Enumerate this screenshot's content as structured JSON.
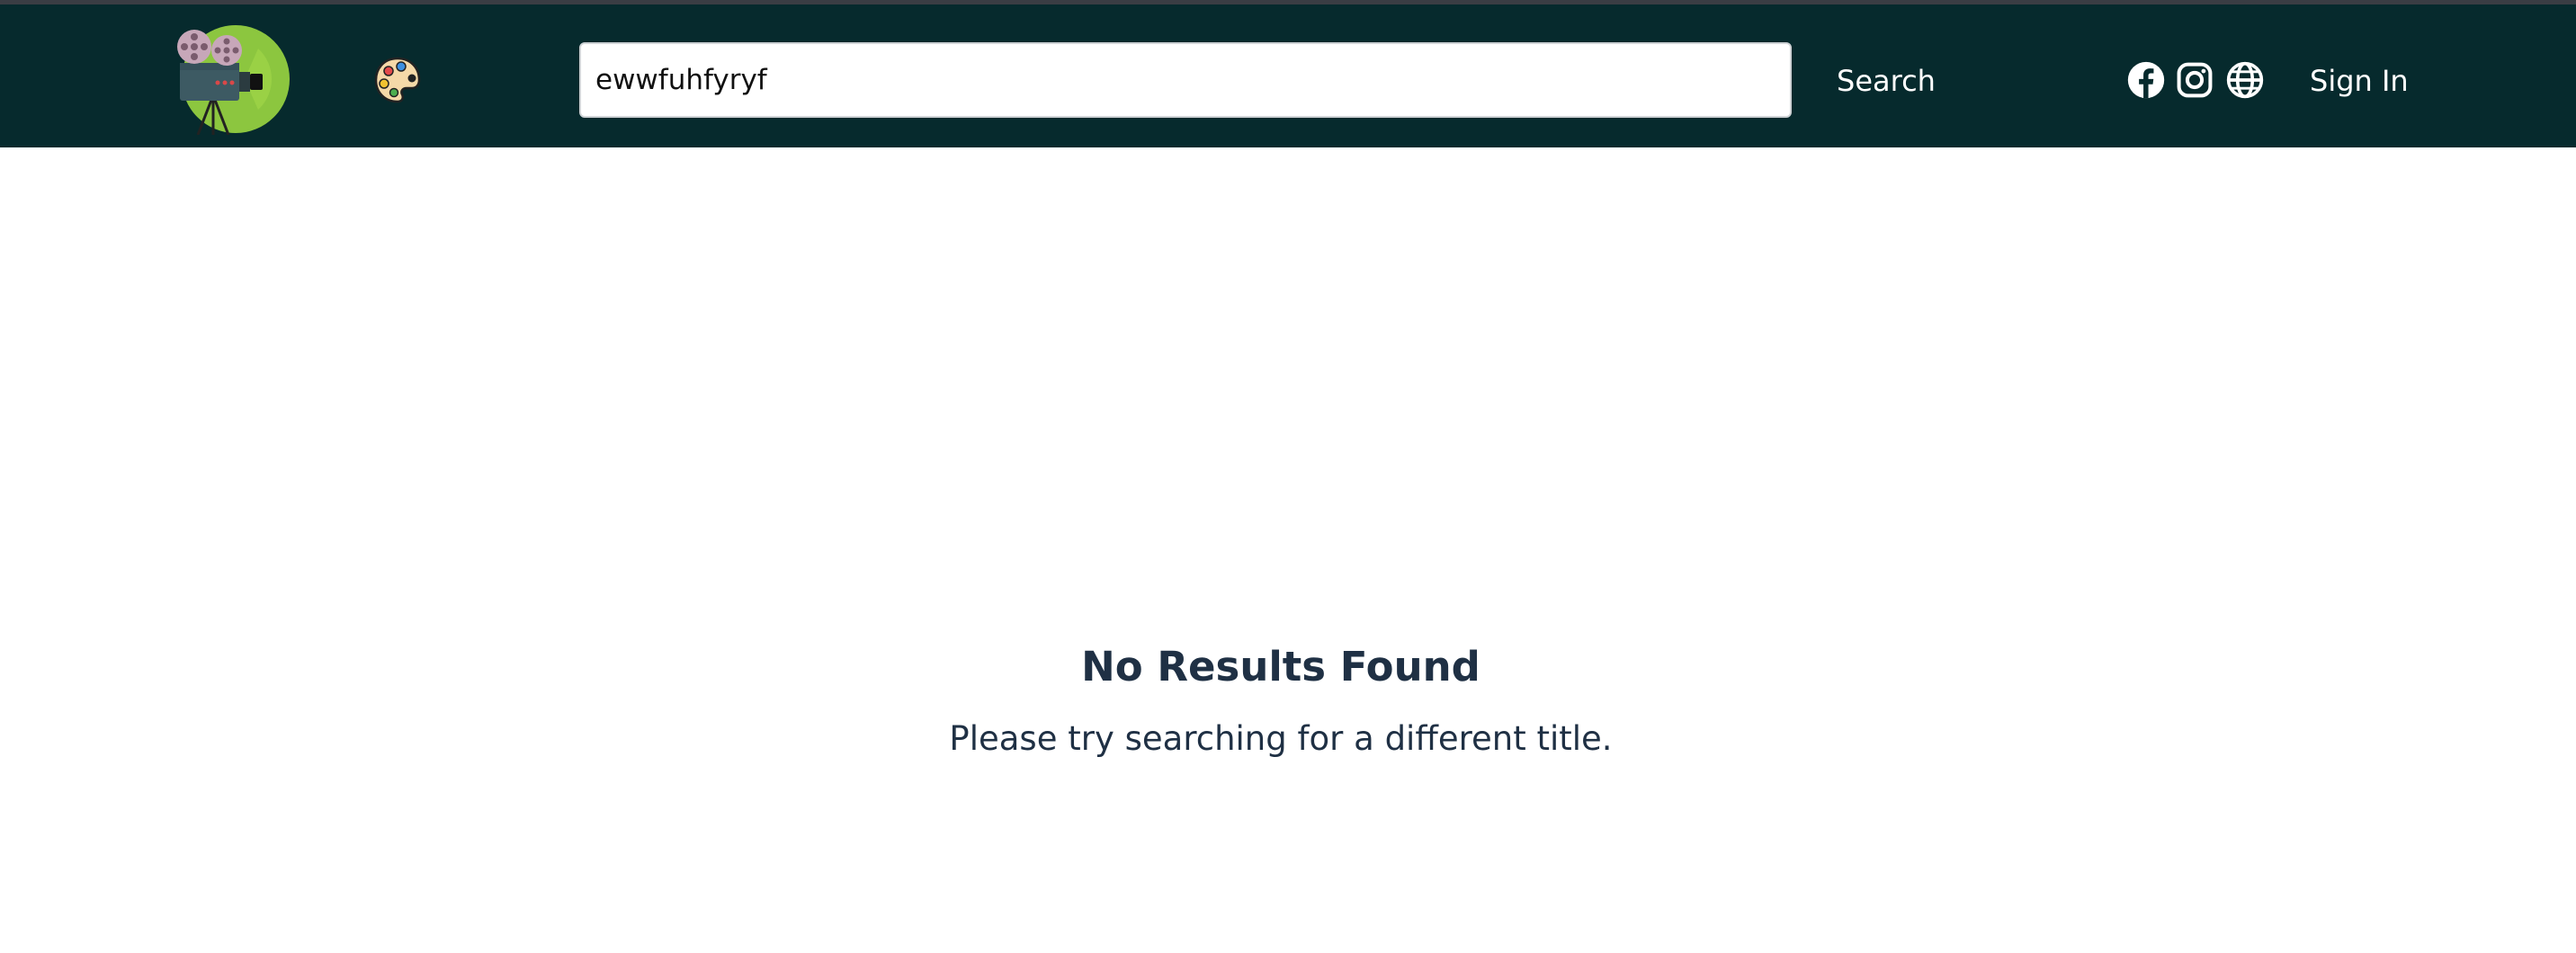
{
  "header": {
    "logo_icon": "film-projector-logo-icon",
    "theme_icon": "palette-icon",
    "search": {
      "value": "ewwfuhfyryf",
      "placeholder": ""
    },
    "search_label": "Search",
    "social_icons": [
      "facebook-icon",
      "instagram-icon",
      "globe-icon"
    ],
    "signin_label": "Sign In",
    "colors": {
      "navbar_bg": "#062a2d",
      "logo_circle": "#8cc63f",
      "text": "#ffffff"
    }
  },
  "main": {
    "title": "No Results Found",
    "subtitle": "Please try searching for a different title."
  }
}
